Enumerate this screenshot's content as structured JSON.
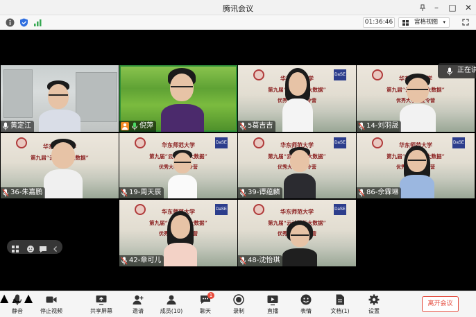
{
  "window": {
    "title": "腾讯会议",
    "minimize": "–",
    "maximize": "□",
    "close": "✕"
  },
  "infobar": {
    "timer": "01:36:46",
    "view_label": "宫格视图",
    "view_caret": "▾"
  },
  "speaking_indicator": {
    "label": "正在讲"
  },
  "tiles": [
    {
      "name": "黄定江"
    },
    {
      "name": "倪萍"
    },
    {
      "name": "5葛吉吉"
    },
    {
      "name": "14-刘羽晟"
    },
    {
      "name": "36-朱嘉鹏"
    },
    {
      "name": "19-周天辰"
    },
    {
      "name": "39-谭蕴麟"
    },
    {
      "name": "86-佘霖琳"
    },
    {
      "name": "42-章可儿"
    },
    {
      "name": "48-沈怡琪"
    }
  ],
  "poster": {
    "line1": "华东师范大学",
    "line2": "第九届“云计算与大数据”",
    "line3": "优秀大学生夏令营",
    "logo": "DaSE"
  },
  "toolbar": {
    "mute": "静音",
    "stop_video": "停止视频",
    "share_screen": "共享屏幕",
    "invite": "邀请",
    "members": "成员(10)",
    "chat": "聊天",
    "chat_badge": "1",
    "record": "录制",
    "live": "直播",
    "emoji": "表情",
    "docs": "文档(1)",
    "settings": "设置",
    "leave": "离开会议"
  },
  "colors": {
    "active_speaker_border": "#2f8f3a",
    "leave_red": "#e34a3c",
    "host_badge": "#f08a24"
  }
}
